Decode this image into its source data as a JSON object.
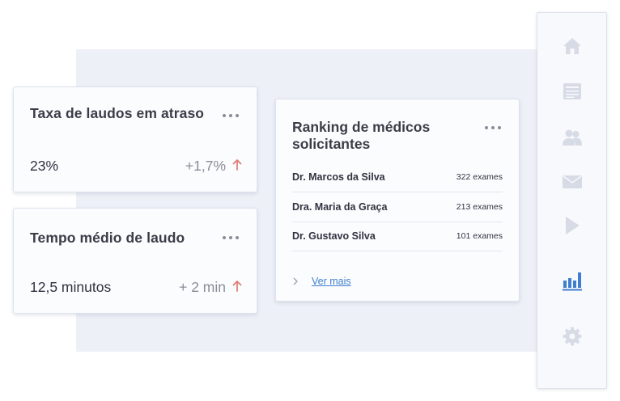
{
  "cards": {
    "late_reports": {
      "title": "Taxa de laudos em atraso",
      "value": "23%",
      "change": "+1,7%"
    },
    "avg_time": {
      "title": "Tempo médio de laudo",
      "value": "12,5 minutos",
      "change": "+ 2 min"
    }
  },
  "ranking": {
    "title": "Ranking de médicos solicitantes",
    "rows": [
      {
        "name": "Dr. Marcos da Silva",
        "count": "322 exames"
      },
      {
        "name": "Dra. Maria da Graça",
        "count": "213 exames"
      },
      {
        "name": "Dr. Gustavo Silva",
        "count": "101 exames"
      }
    ],
    "more_label": "Ver mais"
  },
  "sidebar": {
    "items": [
      {
        "icon": "home-icon",
        "active": false
      },
      {
        "icon": "document-icon",
        "active": false
      },
      {
        "icon": "users-icon",
        "active": false
      },
      {
        "icon": "mail-icon",
        "active": false
      },
      {
        "icon": "play-icon",
        "active": false
      },
      {
        "icon": "bar-chart-icon",
        "active": true
      },
      {
        "icon": "gear-icon",
        "active": false
      }
    ]
  },
  "colors": {
    "accent": "#3f7fcf",
    "trend_up": "#e07f74",
    "icon_muted": "#d6dbe6",
    "backdrop": "#edf0f7"
  }
}
